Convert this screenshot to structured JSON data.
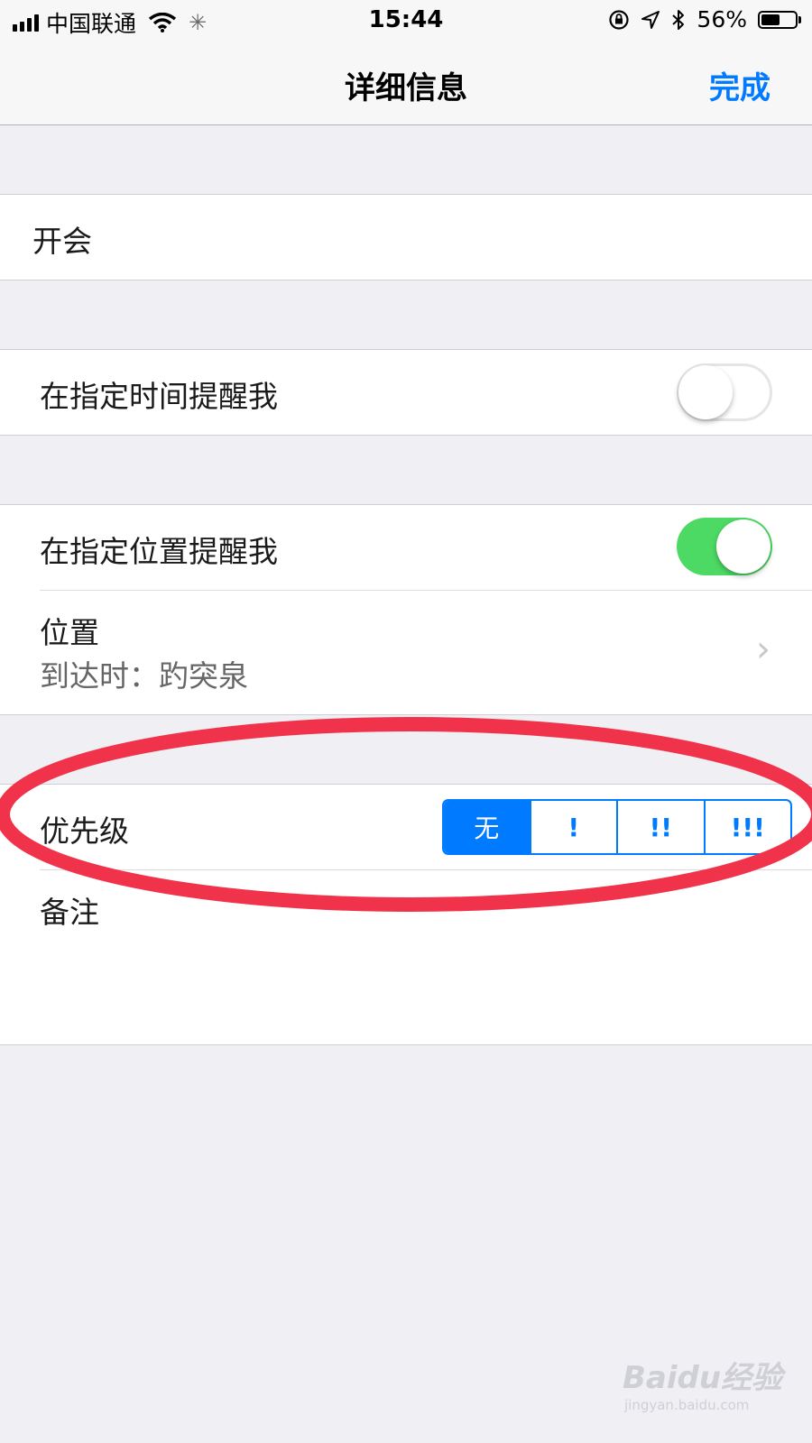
{
  "status_bar": {
    "carrier": "中国联通",
    "time": "15:44",
    "battery": "56%",
    "battery_level": 0.56,
    "icons": [
      "signal-icon",
      "wifi-icon",
      "activity-spinner-icon",
      "orientation-lock-icon",
      "location-arrow-icon",
      "bluetooth-icon",
      "battery-icon"
    ]
  },
  "nav": {
    "title": "详细信息",
    "done": "完成"
  },
  "reminder": {
    "title": "开会"
  },
  "time_reminder": {
    "label": "在指定时间提醒我",
    "enabled": false
  },
  "location_reminder": {
    "label": "在指定位置提醒我",
    "enabled": true,
    "location_label": "位置",
    "location_value": "到达时：趵突泉"
  },
  "priority": {
    "label": "优先级",
    "options": [
      "无",
      "!",
      "!!",
      "!!!"
    ],
    "selected": "无"
  },
  "notes": {
    "label": "备注"
  },
  "watermark": {
    "logo": "Baidu经验",
    "url": "jingyan.baidu.com"
  },
  "colors": {
    "accent": "#007aff",
    "toggle_on": "#4cd964",
    "annotation": "#f0334a",
    "background": "#efeff4"
  }
}
